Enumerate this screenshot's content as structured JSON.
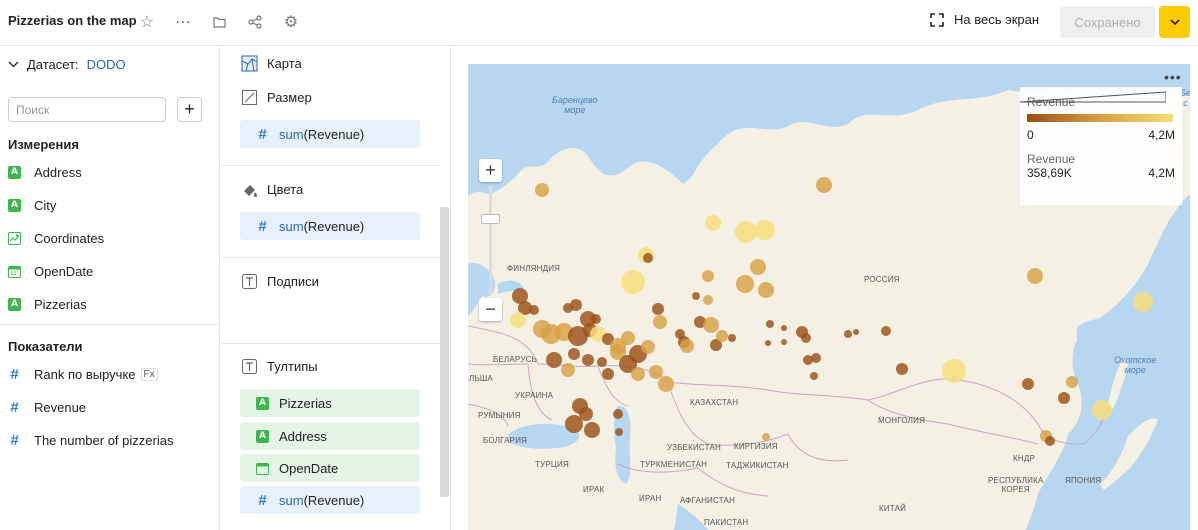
{
  "header": {
    "title": "Pizzerias on the map",
    "fullscreen_label": "На весь экран",
    "saved_label": "Сохранено"
  },
  "left_panel": {
    "dataset_label": "Датасет:",
    "dataset_value": "DODO",
    "search_placeholder": "Поиск",
    "dimensions_header": "Измерения",
    "dimensions": [
      {
        "label": "Address",
        "type": "text"
      },
      {
        "label": "City",
        "type": "text"
      },
      {
        "label": "Coordinates",
        "type": "geo"
      },
      {
        "label": "OpenDate",
        "type": "date"
      },
      {
        "label": "Pizzerias",
        "type": "text"
      }
    ],
    "measures_header": "Показатели",
    "measures": [
      {
        "label": "Rank по выручке",
        "badge": "Fx"
      },
      {
        "label": "Revenue"
      },
      {
        "label": "The number of pizzerias"
      }
    ]
  },
  "config_panel": {
    "map_label": "Карта",
    "size_label": "Размер",
    "size_field": {
      "func": "sum",
      "arg": "(Revenue)"
    },
    "colors_label": "Цвета",
    "colors_field": {
      "func": "sum",
      "arg": "(Revenue)"
    },
    "labels_label": "Подписи",
    "tooltips_label": "Тултипы",
    "tooltip_fields": [
      {
        "label": "Pizzerias",
        "type": "text"
      },
      {
        "label": "Address",
        "type": "text"
      },
      {
        "label": "OpenDate",
        "type": "date"
      },
      {
        "func": "sum",
        "arg": "(Revenue)",
        "type": "measure"
      }
    ]
  },
  "map": {
    "labels": {
      "barents": "Баренцево\nморе",
      "finland": "ФИНЛЯНДИЯ",
      "russia": "РОССИЯ",
      "belarus": "БЕЛАРУСЬ",
      "poland": "ЛЬША",
      "ukraine": "УКРАИНА",
      "romania": "РУМЫНИЯ",
      "bulgaria": "БОЛГАРИЯ",
      "kazakhstan": "КАЗАХСТАН",
      "mongolia": "МОНГОЛИЯ",
      "uzbekistan": "УЗБЕКИСТАН",
      "kyrgyzstan": "КИРГИЗИЯ",
      "turkey": "ТУРЦИЯ",
      "turkmenistan": "ТУРКМЕНИСТАН",
      "tajikistan": "ТАДЖИКИСТАН",
      "iraq": "ИРАК",
      "iran": "ИРАН",
      "afghanistan": "АФГАНИСТАН",
      "china": "КИТАЙ",
      "pakistan": "ПАКИСТАН",
      "kndr": "КНДР",
      "korea": "РЕСПУБЛИКА\nКОРЕЯ",
      "japan": "ЯПОНИЯ",
      "okhotsk": "Охотское\nморе",
      "sea_edge": "Бе\nс"
    },
    "legend": {
      "color_title": "Revenue",
      "color_min": "0",
      "color_max": "4,2M",
      "size_title": "Revenue",
      "size_min": "358,69K",
      "size_max": "4,2M"
    },
    "colors": {
      "low": "#9b4f16",
      "mid": "#d7a044",
      "high": "#f6de78"
    }
  }
}
